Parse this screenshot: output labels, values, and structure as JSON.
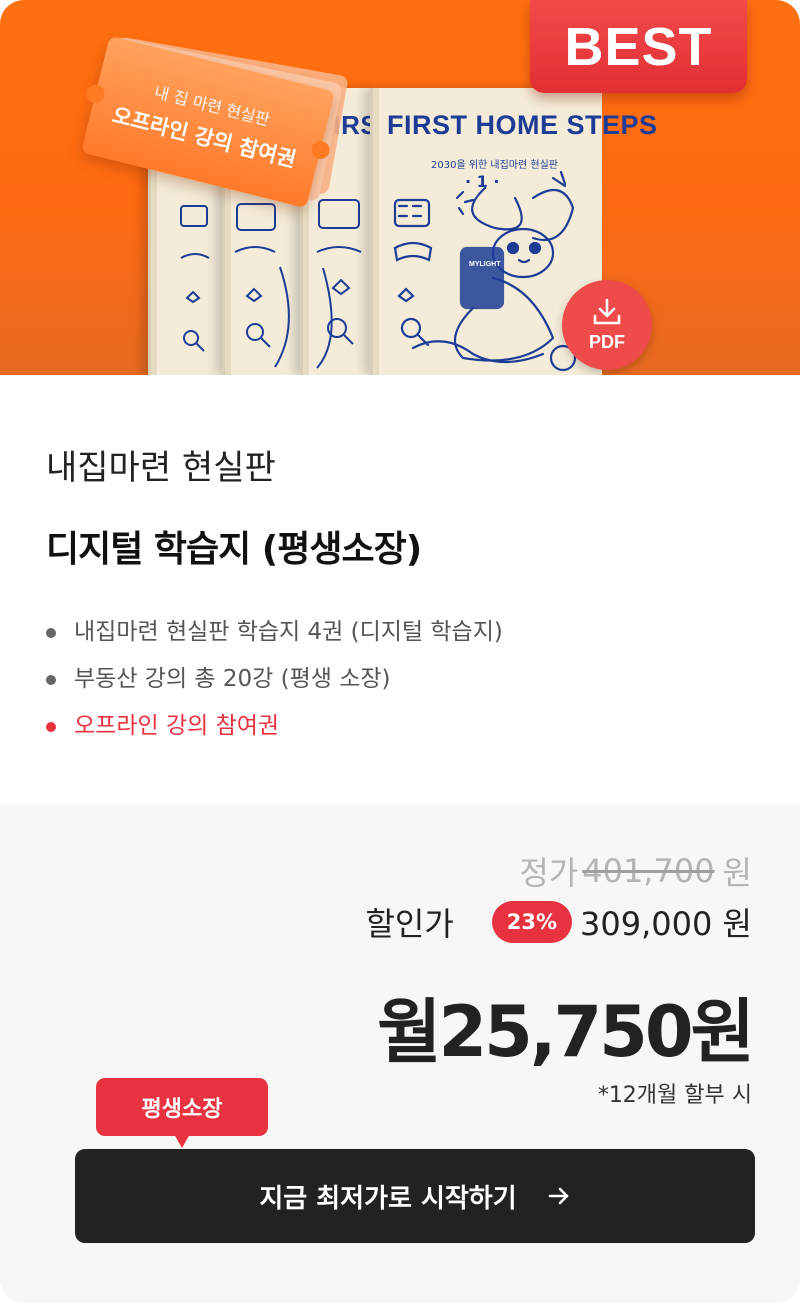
{
  "hero": {
    "best_badge": "BEST",
    "ticket_line1": "내 집 마련 현실판",
    "ticket_line2": "오프라인 강의 참여권",
    "book_title_full": "FIRST HOME STEPS",
    "book_title_partial": "FIRS",
    "book_subtitle": "2030을 위한 내집마련 현실판",
    "book_number": "· 1 ·",
    "book_badge_text": "MYLIGHT",
    "pdf_label": "PDF",
    "icons": [
      "download-icon"
    ]
  },
  "product": {
    "subtitle": "내집마련 현실판",
    "title": "디지털 학습지 (평생소장)",
    "features": [
      {
        "text": "내집마련 현실판 학습지 4권 (디지털 학습지)"
      },
      {
        "text": "부동산 강의 총 20강 (평생 소장)"
      },
      {
        "text": "오프라인 강의 참여권"
      }
    ]
  },
  "pricing": {
    "regular_label": "정가",
    "regular_price": "401,700",
    "currency": "원",
    "sale_label": "할인가",
    "discount": "23%",
    "sale_price": "309,000 원",
    "monthly_price": "월25,750원",
    "installment_note": "*12개월 할부 시"
  },
  "cta": {
    "tooltip": "평생소장",
    "button_label": "지금 최저가로 시작하기"
  },
  "colors": {
    "hero_orange": "#ff6f10",
    "accent_red": "#e8323f",
    "button_dark": "#222222",
    "book_blue": "#1c3c96"
  }
}
